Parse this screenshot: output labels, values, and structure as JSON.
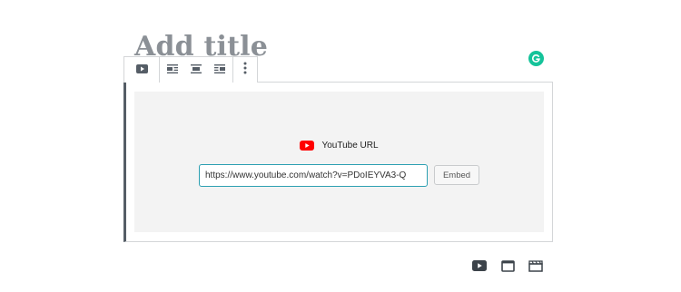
{
  "editor": {
    "title_placeholder": "Add title"
  },
  "block_toolbar": {
    "items": [
      {
        "icon": "youtube-icon"
      },
      {
        "icon": "align-left-icon"
      },
      {
        "icon": "align-center-icon"
      },
      {
        "icon": "align-right-icon"
      },
      {
        "icon": "more-options-icon"
      }
    ]
  },
  "embed": {
    "label": "YouTube URL",
    "url_value": "https://www.youtube.com/watch?v=PDoIEYVA3-Q",
    "button_label": "Embed"
  },
  "bottom_icons": [
    "youtube-icon",
    "window-icon",
    "video-clapper-icon"
  ],
  "colors": {
    "grammarly": "#15c39a",
    "youtube_red": "#ff0000",
    "input_focus": "#2da0b2"
  }
}
